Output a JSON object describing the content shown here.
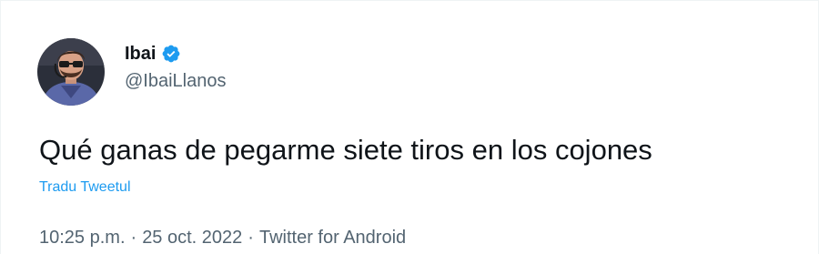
{
  "author": {
    "display_name": "Ibai",
    "handle": "@IbaiLlanos",
    "verified": true
  },
  "tweet": {
    "text": "Qué ganas de pegarme siete tiros en los cojones",
    "translate_label": "Tradu Tweetul"
  },
  "meta": {
    "time": "10:25 p.m.",
    "separator": "·",
    "date": "25 oct. 2022",
    "source": "Twitter for Android"
  },
  "colors": {
    "text_primary": "#0f1419",
    "text_secondary": "#536471",
    "accent": "#1d9bf0",
    "verified_badge": "#1d9bf0"
  },
  "icons": {
    "verified": "verified-badge-icon",
    "avatar": "user-avatar"
  }
}
